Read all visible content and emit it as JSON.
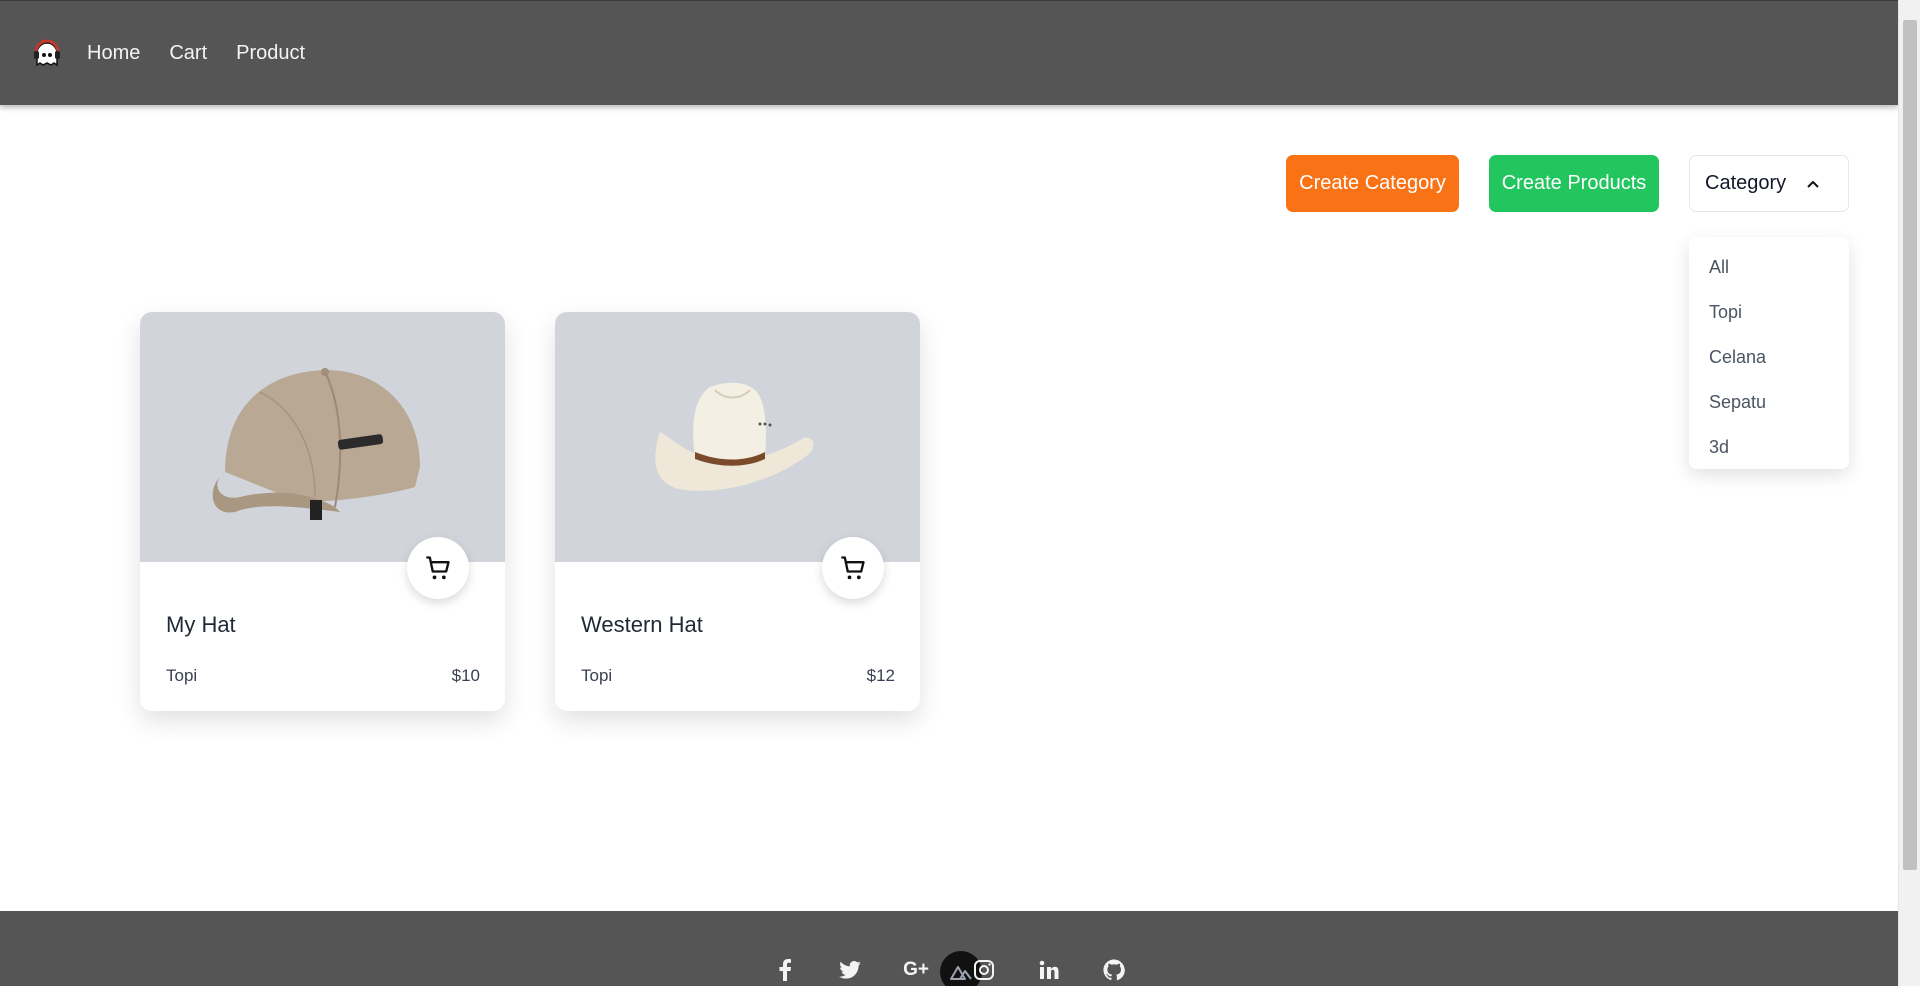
{
  "nav": {
    "logo_icon": "ghost-headphones-logo",
    "links": [
      {
        "label": "Home"
      },
      {
        "label": "Cart"
      },
      {
        "label": "Product"
      }
    ]
  },
  "actions": {
    "create_category": "Create Category",
    "create_products": "Create Products",
    "category_dropdown": {
      "label": "Category",
      "open": true,
      "options": [
        "All",
        "Topi",
        "Celana",
        "Sepatu",
        "3d"
      ]
    }
  },
  "products": [
    {
      "name": "My Hat",
      "category": "Topi",
      "price": "$10",
      "image_icon": "baseball-cap-image"
    },
    {
      "name": "Western Hat",
      "category": "Topi",
      "price": "$12",
      "image_icon": "cowboy-hat-image"
    }
  ],
  "footer": {
    "social_icons": [
      "facebook-icon",
      "twitter-icon",
      "google-plus-icon",
      "instagram-icon",
      "linkedin-icon",
      "github-icon"
    ]
  },
  "colors": {
    "navbar": "#555555",
    "create_category": "#f97316",
    "create_products": "#22c55e",
    "card_image_bg": "#d1d5db"
  }
}
